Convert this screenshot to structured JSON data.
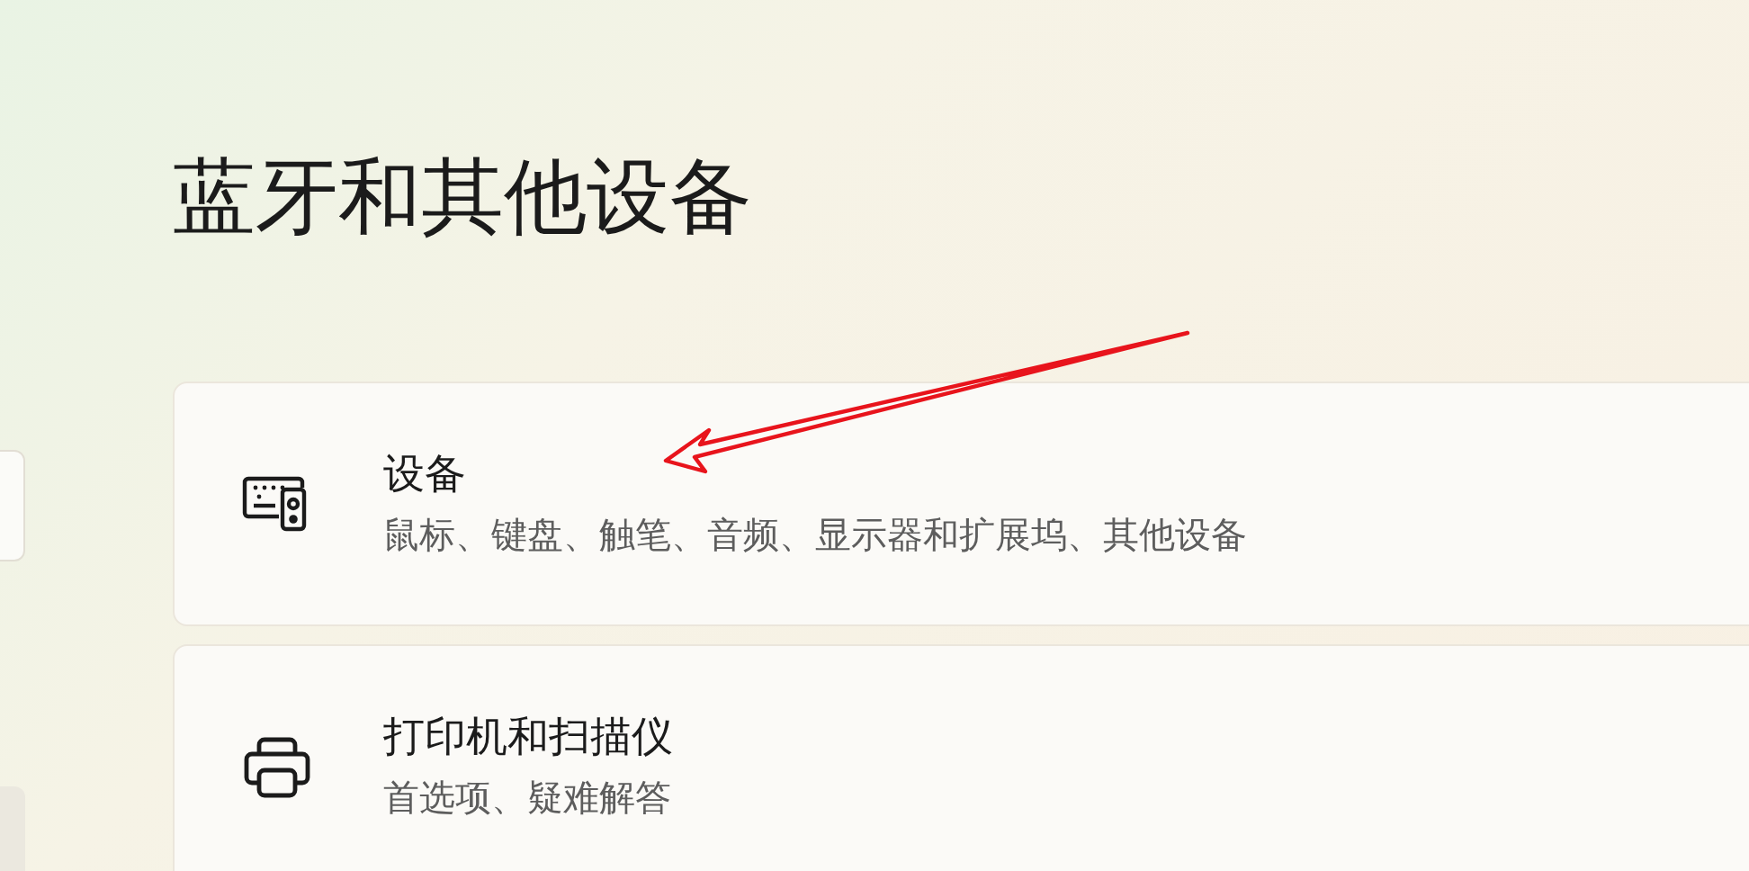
{
  "page_title": "蓝牙和其他设备",
  "cards": [
    {
      "kind": "devices",
      "title": "设备",
      "subtitle": "鼠标、键盘、触笔、音频、显示器和扩展坞、其他设备"
    },
    {
      "kind": "printer",
      "title": "打印机和扫描仪",
      "subtitle": "首选项、疑难解答"
    }
  ]
}
